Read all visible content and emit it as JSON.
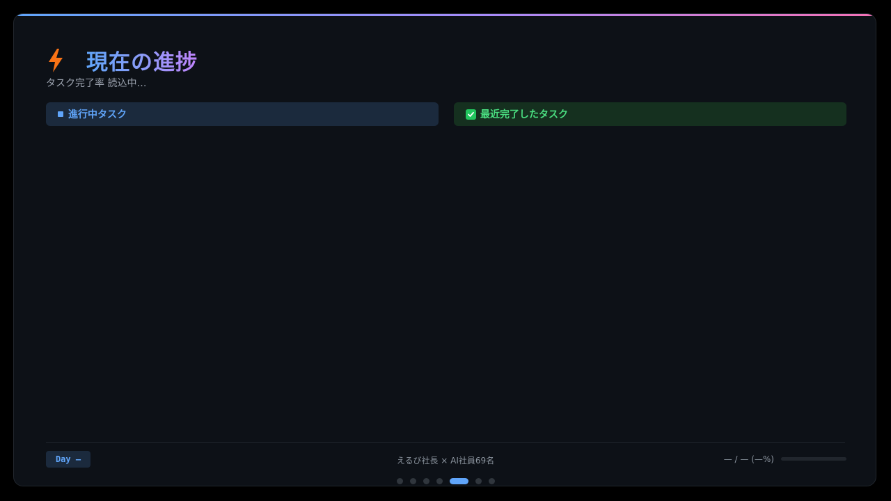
{
  "slide": {
    "title": "現在の進捗",
    "subtitle": "タスク完了率 読込中…",
    "icon": "lightning-bolt-icon"
  },
  "panels": {
    "active_tasks_label": "進行中タスク",
    "completed_tasks_label": "最近完了したタスク"
  },
  "footer": {
    "day_label": "Day —",
    "credit": "えるび社長 × AI社員69名",
    "progress_text": "— / — (—%)",
    "progress_fraction": 0
  },
  "pagination": {
    "total": 7,
    "current_index": 4
  },
  "colors": {
    "accent_blue": "#60a5fa",
    "accent_green": "#4ade80",
    "accent_orange": "#f97316",
    "background": "#0d1117"
  }
}
